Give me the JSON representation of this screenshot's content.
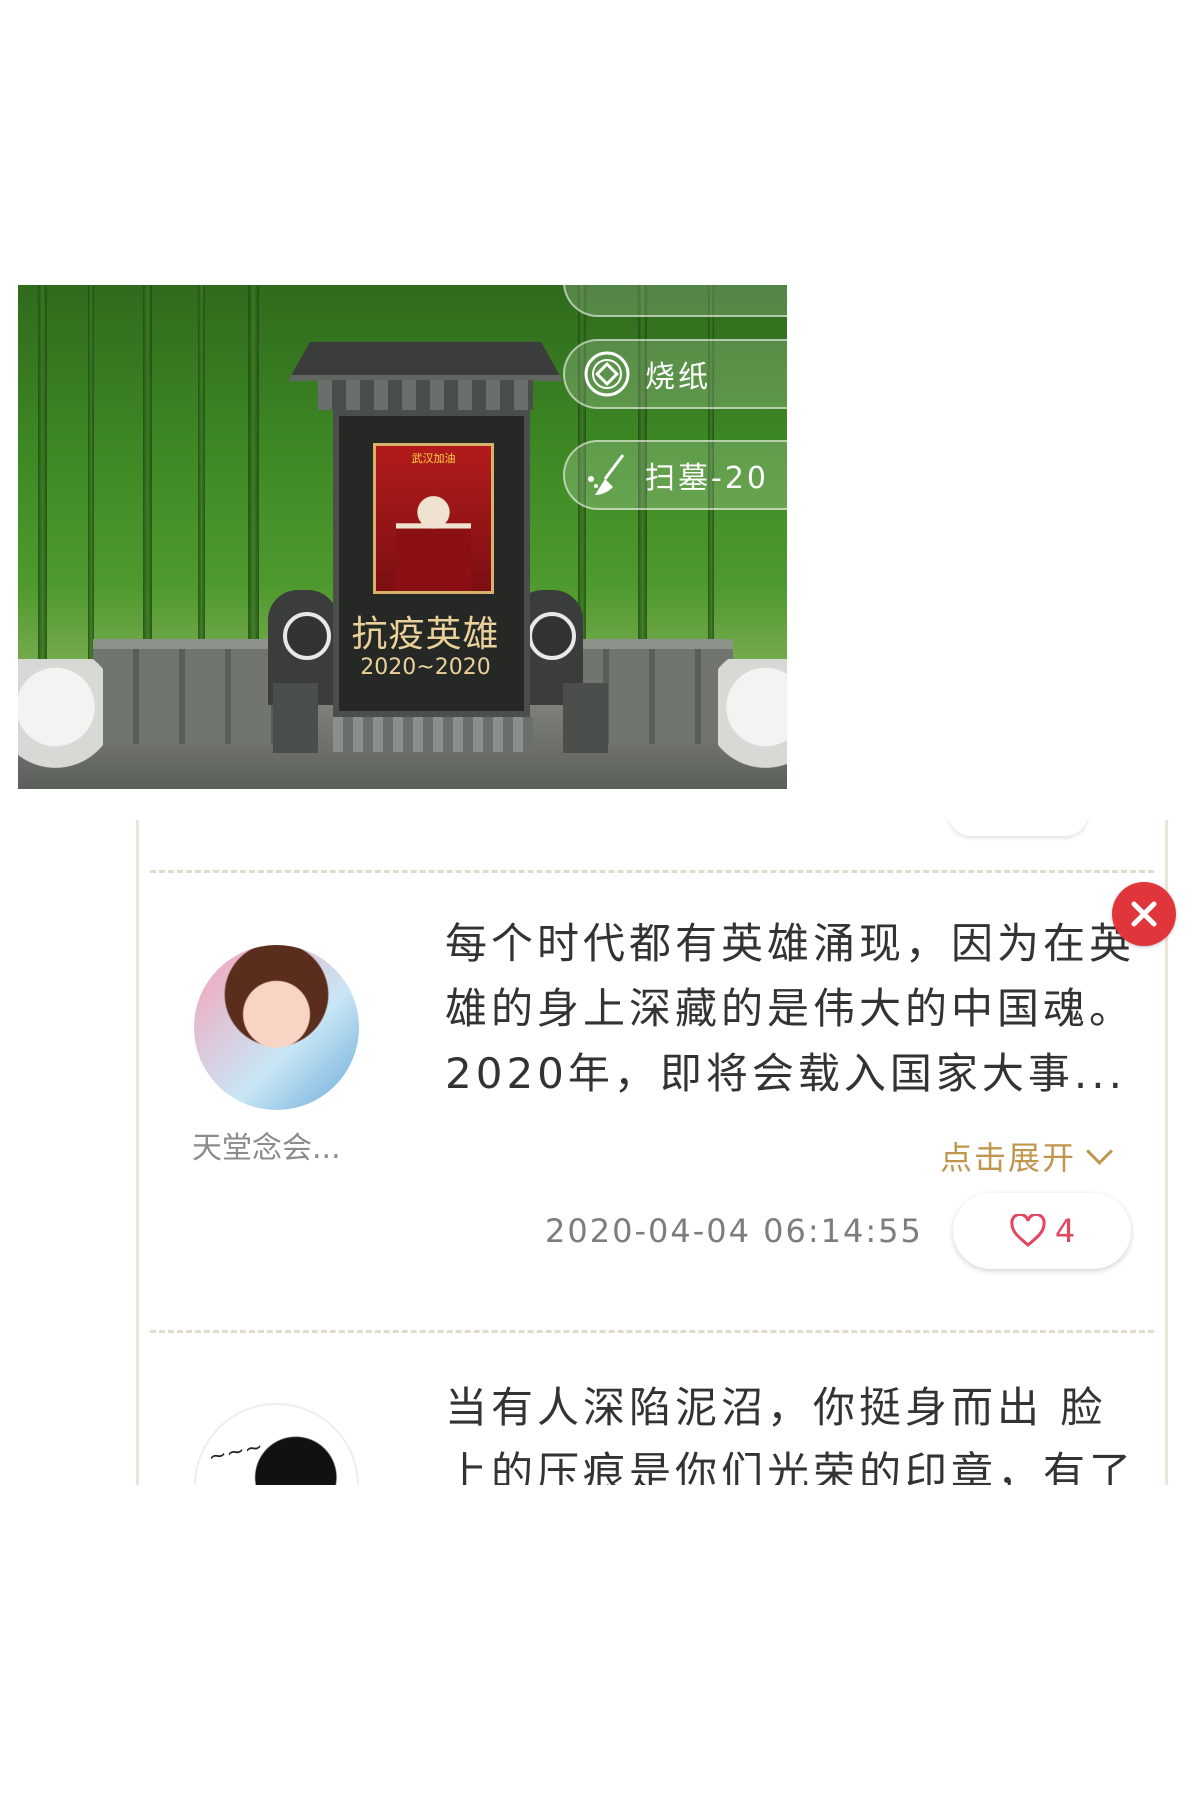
{
  "memorial": {
    "title": "抗疫英雄",
    "years": "2020~2020",
    "portrait_caption": "武汉加油"
  },
  "actions": [
    {
      "label": "烧纸",
      "icon": "coin-icon"
    },
    {
      "label": "扫墓-20",
      "icon": "broom-icon"
    }
  ],
  "comments": [
    {
      "username": "天堂念会...",
      "text_lines": [
        "每个时代都有英雄涌现，因为在英",
        "雄的身上深藏的是伟大的中国魂。",
        "2020年，即将会载入国家大事..."
      ],
      "expand_label": "点击展开",
      "timestamp": "2020-04-04 06:14:55",
      "likes": "4"
    },
    {
      "text_lines": [
        "当有人深陷泥沼，你挺身而出 脸",
        "上的压痕是你们光荣的印章，有了"
      ]
    }
  ],
  "colors": {
    "accent_gold": "#c0964e",
    "delete_red": "#e0363b",
    "like_pink": "#e2475f"
  }
}
